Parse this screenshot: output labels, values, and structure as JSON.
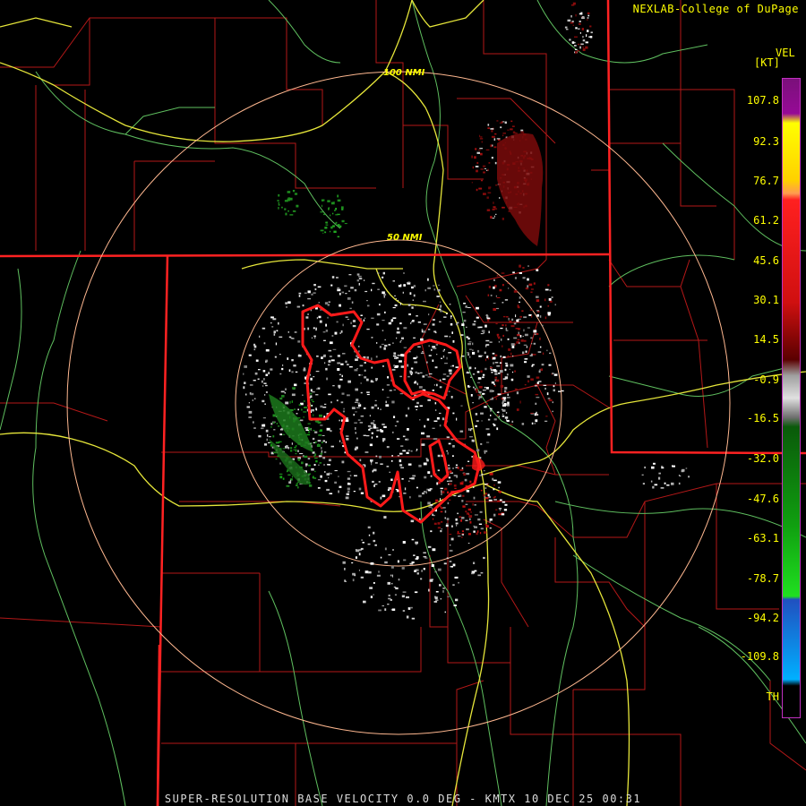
{
  "credit": "NEXLAB-College of DuPage",
  "range_rings": [
    {
      "label": "100 NMI"
    },
    {
      "label": "50 NMI"
    }
  ],
  "legend": {
    "product": "VEL",
    "unit": "[KT]",
    "ticks": [
      "107.8",
      "92.3",
      "76.7",
      "61.2",
      "45.6",
      "30.1",
      "14.5",
      "-0.9",
      "-16.5",
      "-32.0",
      "-47.6",
      "-63.1",
      "-78.7",
      "-94.2",
      "-109.8",
      "TH"
    ]
  },
  "caption": "SUPER-RESOLUTION BASE VELOCITY 0.0 DEG - KMTX 10 DEC 25 00:31",
  "colors": {
    "state_lines": "#ff2020",
    "county_lines": "#c01818",
    "highways": "#e8e83a",
    "rivers": "#66c866",
    "rings": "#ffb890",
    "warning_polygon": "#ff1a1a",
    "text": "#ffff00"
  }
}
